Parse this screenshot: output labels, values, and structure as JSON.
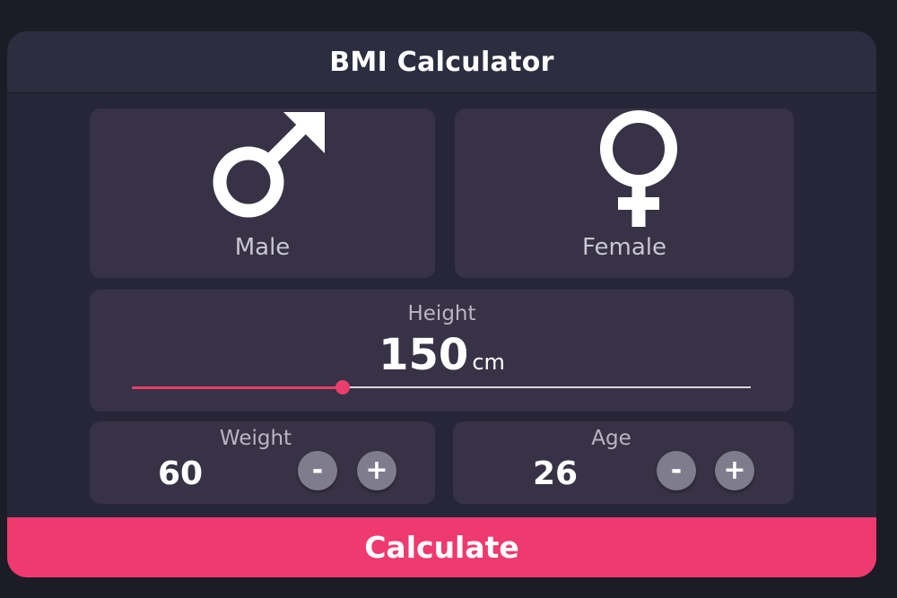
{
  "app": {
    "title": "BMI Calculator"
  },
  "gender": {
    "male": {
      "label": "Male",
      "icon": "male-symbol-icon"
    },
    "female": {
      "label": "Female",
      "icon": "female-symbol-icon"
    }
  },
  "height": {
    "label": "Height",
    "value": "150",
    "unit": "cm",
    "slider_fraction": 0.34
  },
  "weight": {
    "label": "Weight",
    "value": "60",
    "minus_label": "-",
    "plus_label": "+"
  },
  "age": {
    "label": "Age",
    "value": "26",
    "minus_label": "-",
    "plus_label": "+"
  },
  "calculate": {
    "label": "Calculate"
  },
  "colors": {
    "background": "#1b1c25",
    "panel": "#262638",
    "card": "#373245",
    "accent": "#ee3a6e",
    "button": "#7f7c8d"
  }
}
